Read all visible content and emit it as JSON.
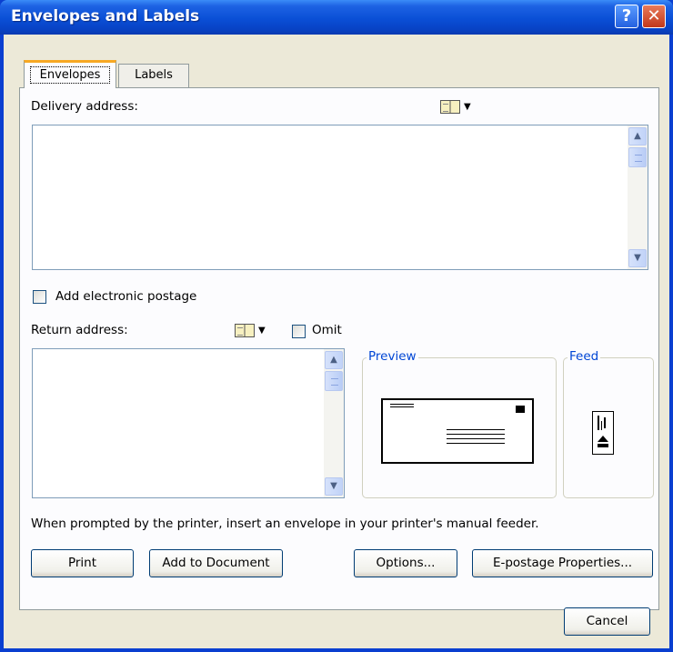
{
  "window": {
    "title": "Envelopes and Labels",
    "help_label": "?",
    "close_label": "✕"
  },
  "tabs": [
    {
      "label": "Envelopes",
      "selected": true
    },
    {
      "label": "Labels",
      "selected": false
    }
  ],
  "delivery": {
    "label": "Delivery address:",
    "value": "",
    "address_book_icon": "address-book-icon",
    "scroll_up": "▲",
    "scroll_down": "▼"
  },
  "postage": {
    "label": "Add electronic postage",
    "checked": false
  },
  "return": {
    "label": "Return address:",
    "value": "",
    "omit_label": "Omit",
    "omit_checked": false,
    "scroll_up": "▲",
    "scroll_down": "▼"
  },
  "preview": {
    "title": "Preview"
  },
  "feed": {
    "title": "Feed"
  },
  "instruction": "When prompted by the printer, insert an envelope in your printer's manual feeder.",
  "buttons": {
    "print": "Print",
    "add_to_document": "Add to Document",
    "options": "Options...",
    "epostage": "E-postage Properties...",
    "cancel": "Cancel"
  },
  "colors": {
    "title_bar": "#0a4fd6",
    "dialog_bg": "#ece9d8",
    "group_title": "#0046d5",
    "tab_highlight": "#f7a823"
  }
}
